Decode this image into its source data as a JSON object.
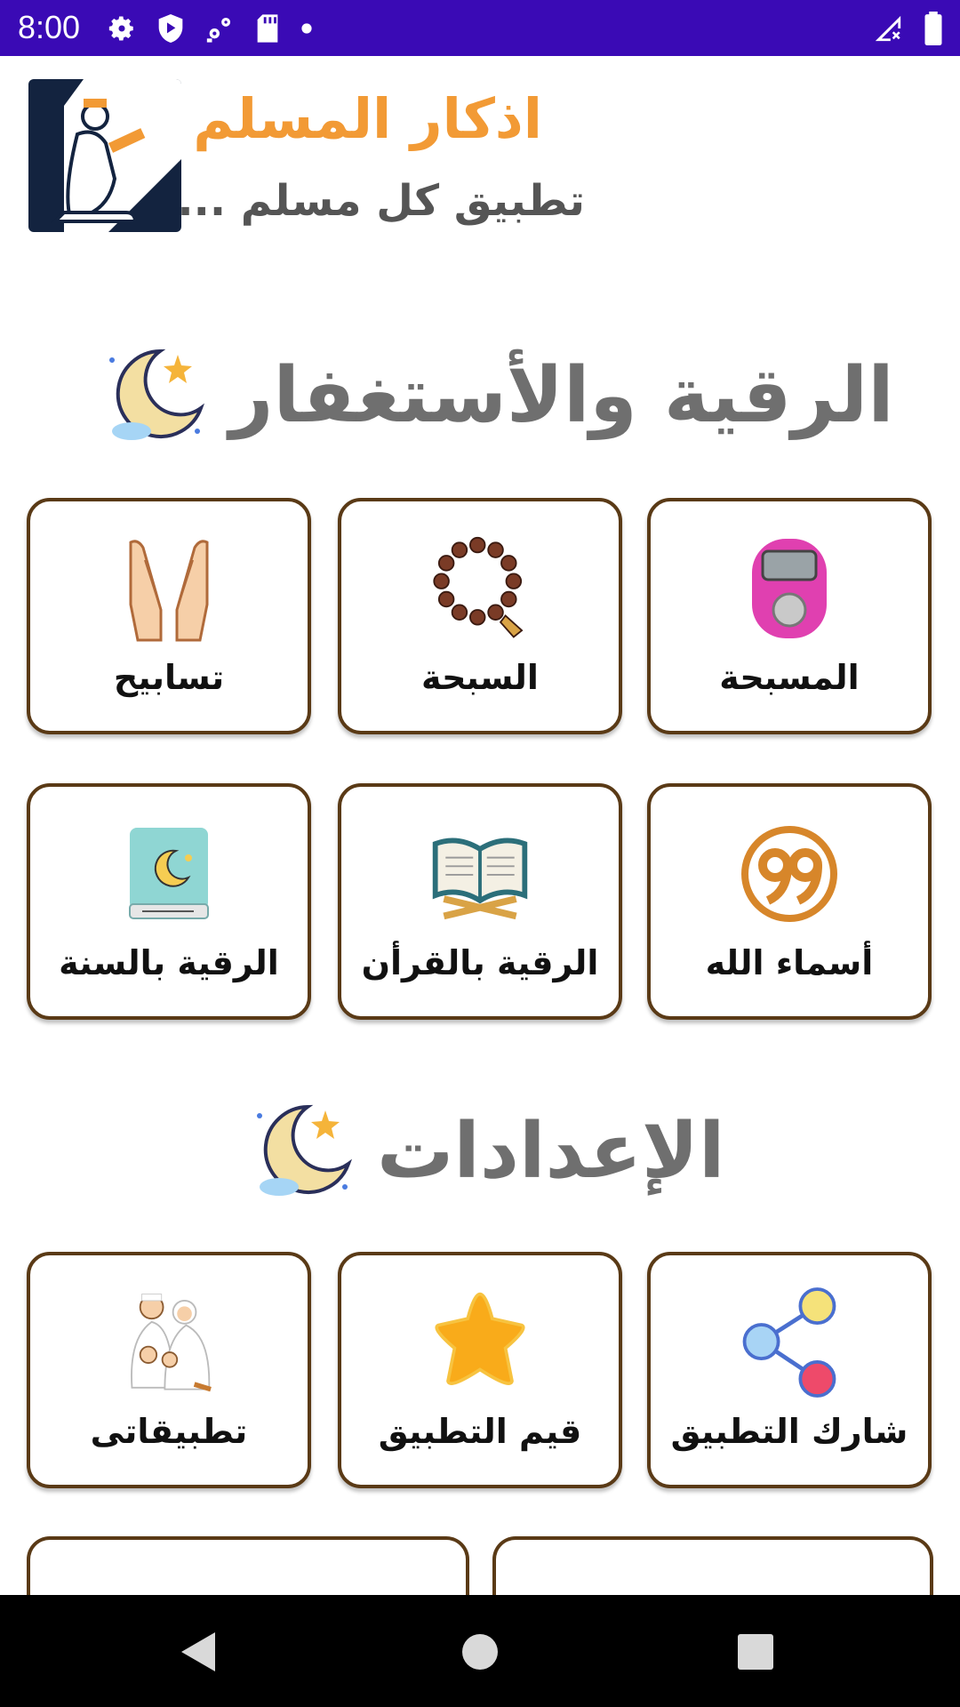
{
  "status_bar": {
    "time": "8:00",
    "left_icons": [
      "settings-icon",
      "play-protect-icon",
      "network-settings-icon",
      "sd-card-icon",
      "dot-icon"
    ],
    "right_icons": [
      "signal-icon",
      "battery-icon"
    ],
    "background": "#3a0ab5"
  },
  "header": {
    "title": "اذكار المسلم",
    "subtitle": "تطبيق كل مسلم ...",
    "title_color": "#f29a35",
    "logo_icon": "praying-man-icon"
  },
  "sections": [
    {
      "title": "الرقية والأستغفار",
      "icon": "crescent-moon-star-icon",
      "cards": [
        {
          "label": "المسبحة",
          "icon": "tally-counter-icon"
        },
        {
          "label": "السبحة",
          "icon": "prayer-beads-icon"
        },
        {
          "label": "تسابيح",
          "icon": "praying-hands-icon"
        },
        {
          "label": "أسماء الله",
          "icon": "ninety-nine-icon"
        },
        {
          "label": "الرقية بالقرأن",
          "icon": "quran-book-icon"
        },
        {
          "label": "الرقية بالسنة",
          "icon": "sunnah-book-icon"
        }
      ]
    },
    {
      "title": "الإعدادات",
      "icon": "crescent-moon-star-icon",
      "cards": [
        {
          "label": "شارك التطبيق",
          "icon": "share-icon"
        },
        {
          "label": "قيم التطبيق",
          "icon": "star-icon"
        },
        {
          "label": "تطبيقاتى",
          "icon": "family-icon"
        }
      ]
    }
  ],
  "nav_bar": {
    "buttons": [
      "back-icon",
      "home-icon",
      "recents-icon"
    ]
  },
  "colors": {
    "card_border": "#5a3a16",
    "section_title": "#6f6f6f"
  }
}
